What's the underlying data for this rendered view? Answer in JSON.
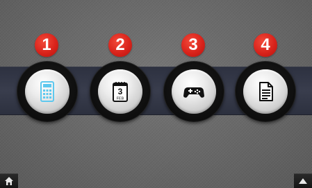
{
  "apps": [
    {
      "number": "1",
      "icon": "calculator-icon"
    },
    {
      "number": "2",
      "icon": "calendar-icon",
      "calendar_day": "3",
      "calendar_month": "FEB"
    },
    {
      "number": "3",
      "icon": "gamepad-icon"
    },
    {
      "number": "4",
      "icon": "document-icon"
    }
  ],
  "colors": {
    "badge": "#d9231b",
    "calculator": "#5ec8ee",
    "band": "#353948",
    "background": "#6c6c6c"
  },
  "footer": {
    "left_icon": "home-icon",
    "right_icon": "up-arrow-icon"
  }
}
